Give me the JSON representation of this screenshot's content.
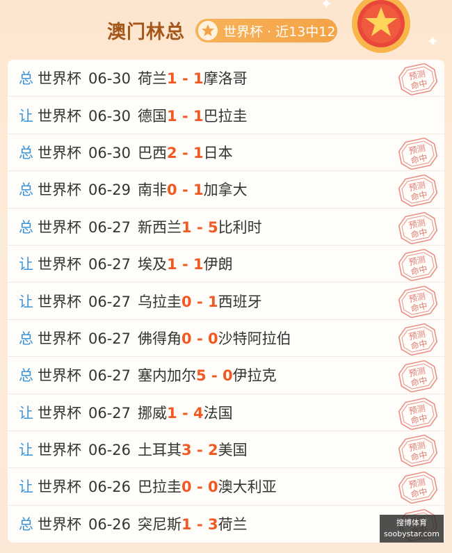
{
  "header": {
    "title": "澳门林总",
    "badge_text": "世界杯 · 近13中12"
  },
  "stamp_text": "预测命中",
  "matches": [
    {
      "kind": "总",
      "league": "世界杯",
      "date": "06-30",
      "home": "荷兰",
      "score": "1 - 1",
      "away": "摩洛哥",
      "hit": true
    },
    {
      "kind": "让",
      "league": "世界杯",
      "date": "06-30",
      "home": "德国",
      "score": "1 - 1",
      "away": "巴拉圭",
      "hit": false
    },
    {
      "kind": "总",
      "league": "世界杯",
      "date": "06-30",
      "home": "巴西",
      "score": "2 - 1",
      "away": "日本",
      "hit": true
    },
    {
      "kind": "总",
      "league": "世界杯",
      "date": "06-29",
      "home": "南非",
      "score": "0 - 1",
      "away": "加拿大",
      "hit": true
    },
    {
      "kind": "总",
      "league": "世界杯",
      "date": "06-27",
      "home": "新西兰",
      "score": "1 - 5",
      "away": "比利时",
      "hit": true
    },
    {
      "kind": "让",
      "league": "世界杯",
      "date": "06-27",
      "home": "埃及",
      "score": "1 - 1",
      "away": "伊朗",
      "hit": true
    },
    {
      "kind": "让",
      "league": "世界杯",
      "date": "06-27",
      "home": "乌拉圭",
      "score": "0 - 1",
      "away": "西班牙",
      "hit": true
    },
    {
      "kind": "总",
      "league": "世界杯",
      "date": "06-27",
      "home": "佛得角",
      "score": "0 - 0",
      "away": "沙特阿拉伯",
      "hit": true
    },
    {
      "kind": "总",
      "league": "世界杯",
      "date": "06-27",
      "home": "塞内加尔",
      "score": "5 - 0",
      "away": "伊拉克",
      "hit": true
    },
    {
      "kind": "让",
      "league": "世界杯",
      "date": "06-27",
      "home": "挪威",
      "score": "1 - 4",
      "away": "法国",
      "hit": true
    },
    {
      "kind": "让",
      "league": "世界杯",
      "date": "06-26",
      "home": "土耳其",
      "score": "3 - 2",
      "away": "美国",
      "hit": true
    },
    {
      "kind": "让",
      "league": "世界杯",
      "date": "06-26",
      "home": "巴拉圭",
      "score": "0 - 0",
      "away": "澳大利亚",
      "hit": true
    },
    {
      "kind": "总",
      "league": "世界杯",
      "date": "06-26",
      "home": "突尼斯",
      "score": "1 - 3",
      "away": "荷兰",
      "hit": true
    }
  ],
  "watermark": {
    "line1": "搜博体育",
    "line2": "soobystar.com"
  },
  "colors": {
    "accent": "#f05a22",
    "kind": "#3a93d8",
    "title": "#a4561a",
    "pill": "#f4a346"
  }
}
